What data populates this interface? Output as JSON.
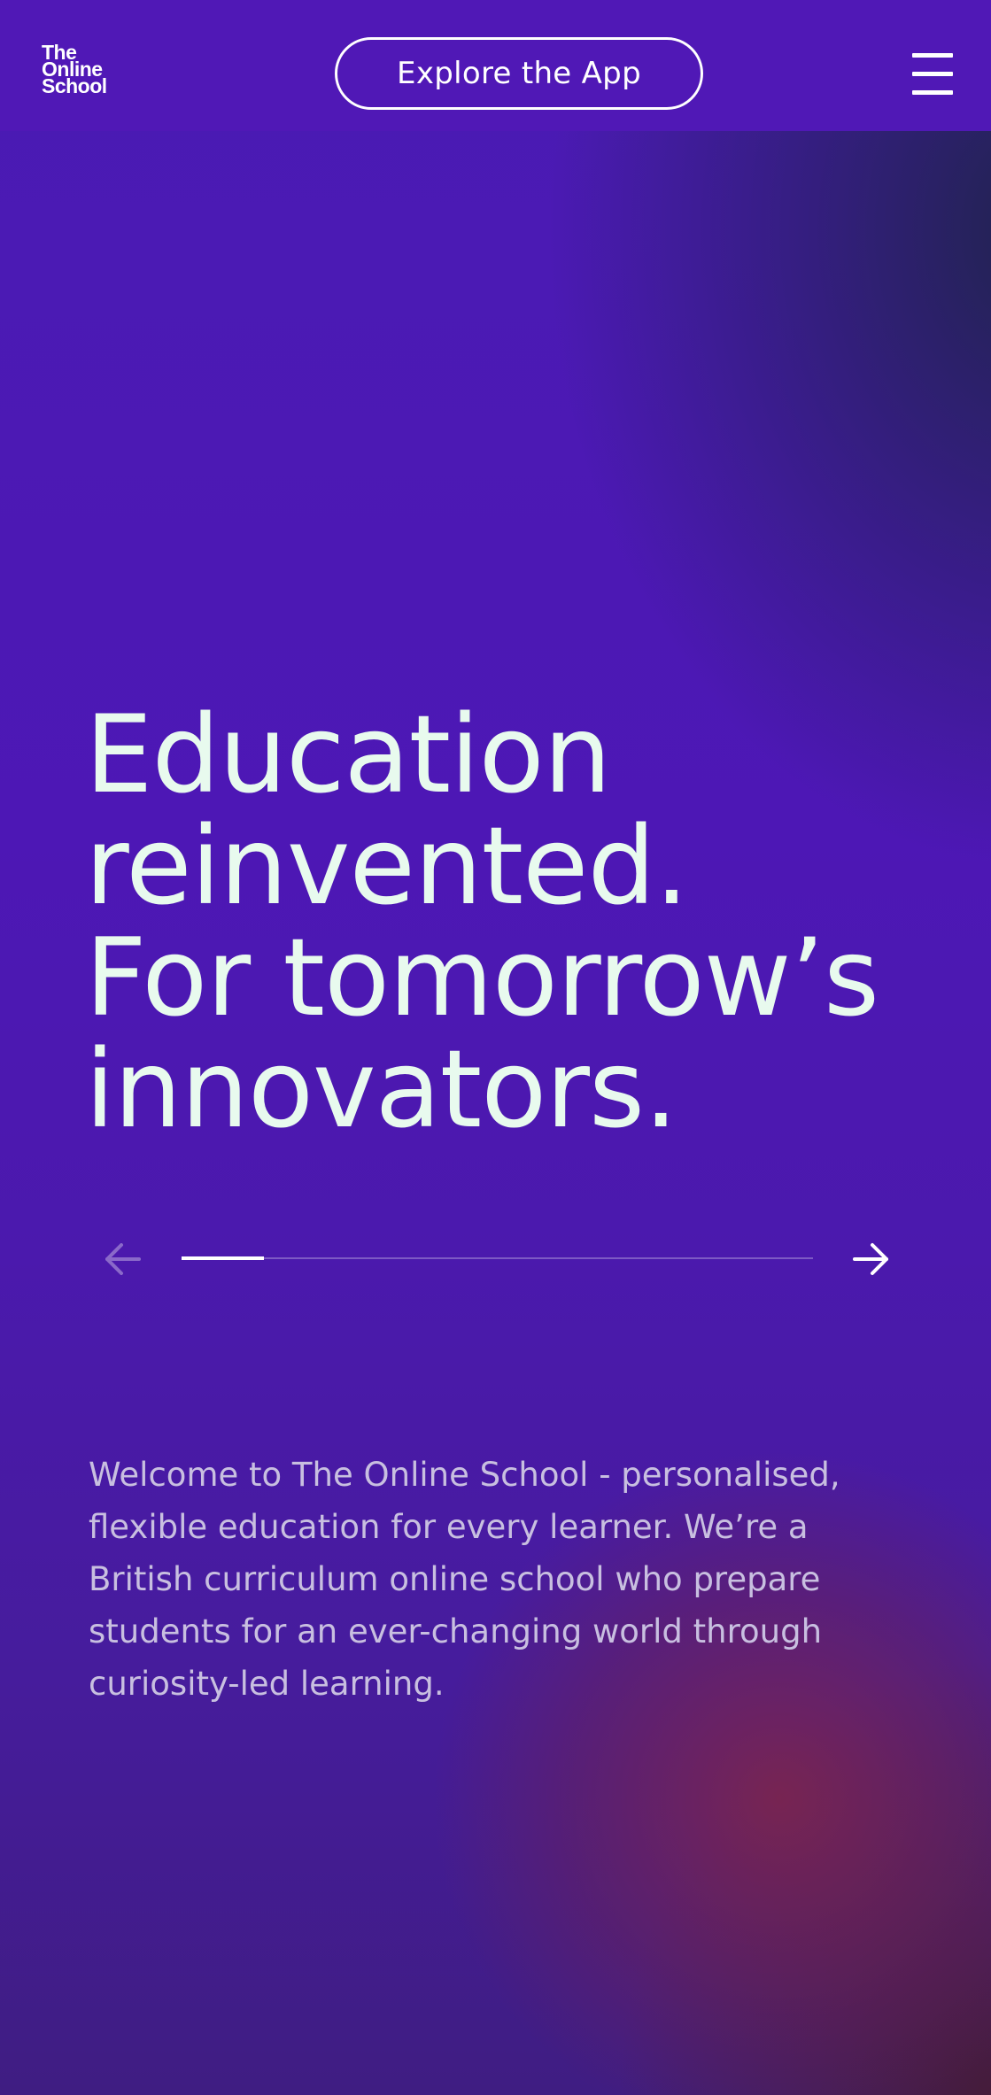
{
  "header": {
    "logo_lines": [
      "The",
      "Online",
      "School"
    ],
    "explore_label": "Explore the App",
    "menu_icon": "hamburger-menu-icon"
  },
  "hero": {
    "title_lines": [
      "Education",
      "reinvented.",
      "For tomorrow’s",
      "innovators."
    ],
    "slider": {
      "prev_icon": "arrow-left-icon",
      "next_icon": "arrow-right-icon",
      "progress_fraction": 0.13
    }
  },
  "intro": {
    "lines": [
      "Welcome to The Online School - personalised,",
      "flexible education for every learner. We’re a",
      "British curriculum online school who prepare",
      "students for an ever-changing world through",
      "curiosity-led learning."
    ]
  },
  "colors": {
    "header_bg": "#5018b6",
    "hero_text": "#e8faee",
    "body_text": "#c8bfe0"
  }
}
